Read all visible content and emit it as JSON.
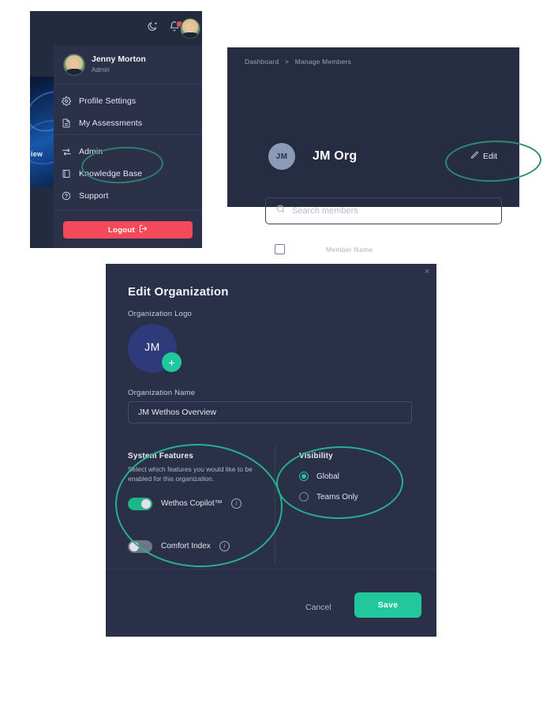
{
  "profile_menu": {
    "topbar": {
      "dark_mode_icon": "moon-icon",
      "notifications_icon": "bell-icon",
      "has_notification_dot": true,
      "avatar_icon": "user-avatar"
    },
    "background_text": "iew",
    "user": {
      "name": "Jenny Morton",
      "role": "Admin"
    },
    "items": [
      {
        "label": "Profile Settings",
        "icon": "gear-icon"
      },
      {
        "label": "My Assessments",
        "icon": "document-icon"
      },
      {
        "label": "Admin",
        "icon": "swap-arrows-icon",
        "highlighted": true
      },
      {
        "label": "Knowledge Base",
        "icon": "book-icon"
      },
      {
        "label": "Support",
        "icon": "question-circle-icon"
      }
    ],
    "logout_label": "Logout"
  },
  "manage_members": {
    "breadcrumb": {
      "root": "Dashboard",
      "separator": ">",
      "current": "Manage Members"
    },
    "org": {
      "initials": "JM",
      "name": "JM Org"
    },
    "edit_label": "Edit",
    "search_placeholder": "Search members",
    "table": {
      "columns": [
        "Member Name"
      ]
    }
  },
  "edit_organization": {
    "title": "Edit Organization",
    "logo_label": "Organization Logo",
    "logo_initials": "JM",
    "logo_add_label": "+",
    "name_label": "Organization Name",
    "name_value": "JM Wethos Overview",
    "system_features": {
      "heading": "System Features",
      "description": "Select which features you would like to be enabled for this organization.",
      "toggles": [
        {
          "label": "Wethos Copilot™",
          "enabled": true,
          "has_info": true
        },
        {
          "label": "Comfort Index",
          "enabled": false,
          "has_info": true
        }
      ]
    },
    "visibility": {
      "heading": "Visibility",
      "options": [
        {
          "label": "Global",
          "selected": true
        },
        {
          "label": "Teams Only",
          "selected": false
        }
      ]
    },
    "footer": {
      "cancel_label": "Cancel",
      "save_label": "Save"
    }
  },
  "annotations": {
    "highlight_color": "#27b08e",
    "rings": [
      "admin-menu-item",
      "edit-button",
      "system-features-section",
      "visibility-section"
    ]
  },
  "colors": {
    "accent_teal": "#22c79b",
    "danger_red": "#f4495a",
    "panel_bg": "#2a3047",
    "menu_bg": "#2a3149"
  }
}
